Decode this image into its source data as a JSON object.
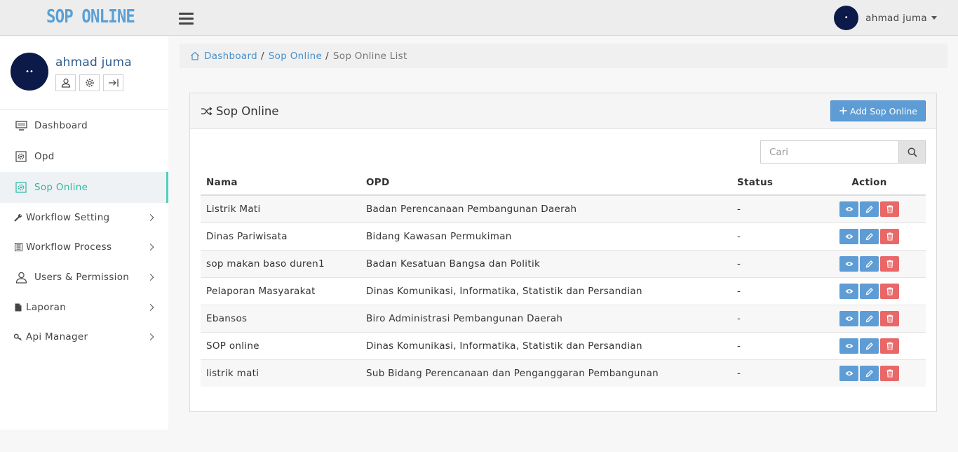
{
  "app": {
    "logo": "SOP ONLINE"
  },
  "user": {
    "name": "ahmad juma",
    "avatar_text": "••"
  },
  "sidebar": {
    "items": [
      {
        "label": "Dashboard",
        "icon": "monitor-icon",
        "active": false,
        "submenu": false
      },
      {
        "label": "Opd",
        "icon": "cog-square-icon",
        "active": false,
        "submenu": false
      },
      {
        "label": "Sop Online",
        "icon": "cog-square-icon",
        "active": true,
        "submenu": false
      },
      {
        "label": "Workflow Setting",
        "icon": "wrench-icon",
        "active": false,
        "submenu": true
      },
      {
        "label": "Workflow Process",
        "icon": "list-icon",
        "active": false,
        "submenu": true
      },
      {
        "label": "Users & Permission",
        "icon": "user-icon",
        "active": false,
        "submenu": true
      },
      {
        "label": "Laporan",
        "icon": "file-icon",
        "active": false,
        "submenu": true
      },
      {
        "label": "Api Manager",
        "icon": "key-icon",
        "active": false,
        "submenu": true
      }
    ]
  },
  "breadcrumb": {
    "home": "Dashboard",
    "section": "Sop Online",
    "current": "Sop Online List"
  },
  "panel": {
    "title": "Sop Online",
    "add_button": "Add Sop Online",
    "search_placeholder": "Cari"
  },
  "table": {
    "headers": {
      "nama": "Nama",
      "opd": "OPD",
      "status": "Status",
      "action": "Action"
    },
    "rows": [
      {
        "nama": "Listrik Mati",
        "opd": "Badan Perencanaan Pembangunan Daerah",
        "status": "-"
      },
      {
        "nama": "Dinas Pariwisata",
        "opd": "Bidang Kawasan Permukiman",
        "status": "-"
      },
      {
        "nama": "sop makan baso duren1",
        "opd": "Badan Kesatuan Bangsa dan Politik",
        "status": "-"
      },
      {
        "nama": "Pelaporan Masyarakat",
        "opd": "Dinas Komunikasi, Informatika, Statistik dan Persandian",
        "status": "-"
      },
      {
        "nama": "Ebansos",
        "opd": "Biro Administrasi Pembangunan Daerah",
        "status": "-"
      },
      {
        "nama": "SOP online",
        "opd": "Dinas Komunikasi, Informatika, Statistik dan Persandian",
        "status": "-"
      },
      {
        "nama": "listrik mati",
        "opd": "Sub Bidang Perencanaan dan Penganggaran Pembangunan",
        "status": "-"
      }
    ]
  },
  "colors": {
    "brand": "#5aa0d6",
    "primary": "#5d9cd4",
    "danger": "#e96767",
    "active_menu": "#2bb8a4",
    "avatar": "#0b1a48"
  }
}
